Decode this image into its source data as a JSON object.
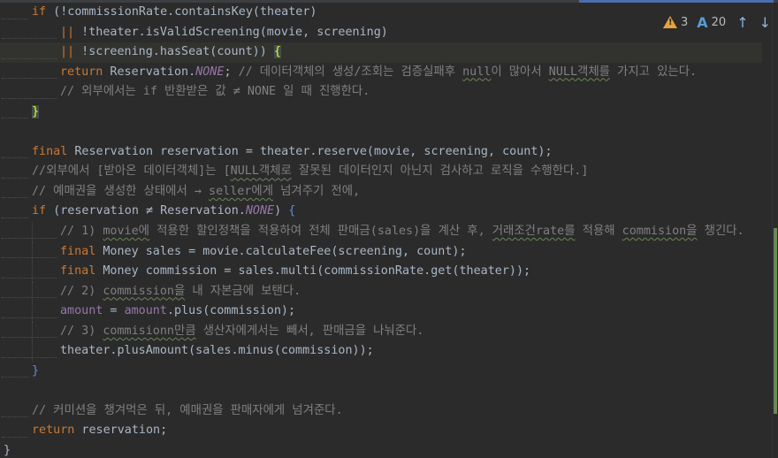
{
  "inspection": {
    "warnings_count": "3",
    "typos_count": "20",
    "up_arrow": "↑",
    "down_arrow": "↓"
  },
  "code_lines": [
    "if (!commissionRate.containsKey(theater)",
    "|| !theater.isValidScreening(movie, screening)",
    "|| !screening.hasSeat(count)) {",
    "return Reservation.NONE; // 데이터객체의 생성/조회는 검증실패후 null이 많아서 NULL객체를 가지고 있는다.",
    "// 외부에서는 if 반환받은 값 ≠ NONE 일 때 진행한다.",
    "}",
    "",
    "final Reservation reservation = theater.reserve(movie, screening, count);",
    "//외부에서 [받아온 데이터객체]는 [NULL객체로 잘못된 데이터인지 아닌지 검사하고 로직을 수행한다.]",
    "// 예매권을 생성한 상태에서 → seller에게 넘겨주기 전에,",
    "if (reservation ≠ Reservation.NONE) {",
    "// 1) movie에 적용한 할인정책을 적용하여 전체 판매금(sales)을 계산 후, 거래조건rate를 적용해 commision을 챙긴다.",
    "final Money sales = movie.calculateFee(screening, count);",
    "final Money commission = sales.multi(commissionRate.get(theater));",
    "// 2) commission을 내 자본금에 보탠다.",
    "amount = amount.plus(commission);",
    "// 3) commisionn만큼 생산자에게서는 빼서, 판매금을 나눠준다.",
    "theater.plusAmount(sales.minus(commission));",
    "}",
    "",
    "// 커미션을 챙겨먹은 뒤, 예매권을 판매자에게 넘겨준다.",
    "return reservation;",
    "}"
  ],
  "colors": {
    "background": "#2b2b2b",
    "keyword": "#cc7832",
    "static_field": "#9876aa",
    "method": "#ffc66d",
    "comment": "#808080",
    "text": "#a9b7c6",
    "warning": "#e6a23c",
    "typo": "#5b9bd5"
  }
}
